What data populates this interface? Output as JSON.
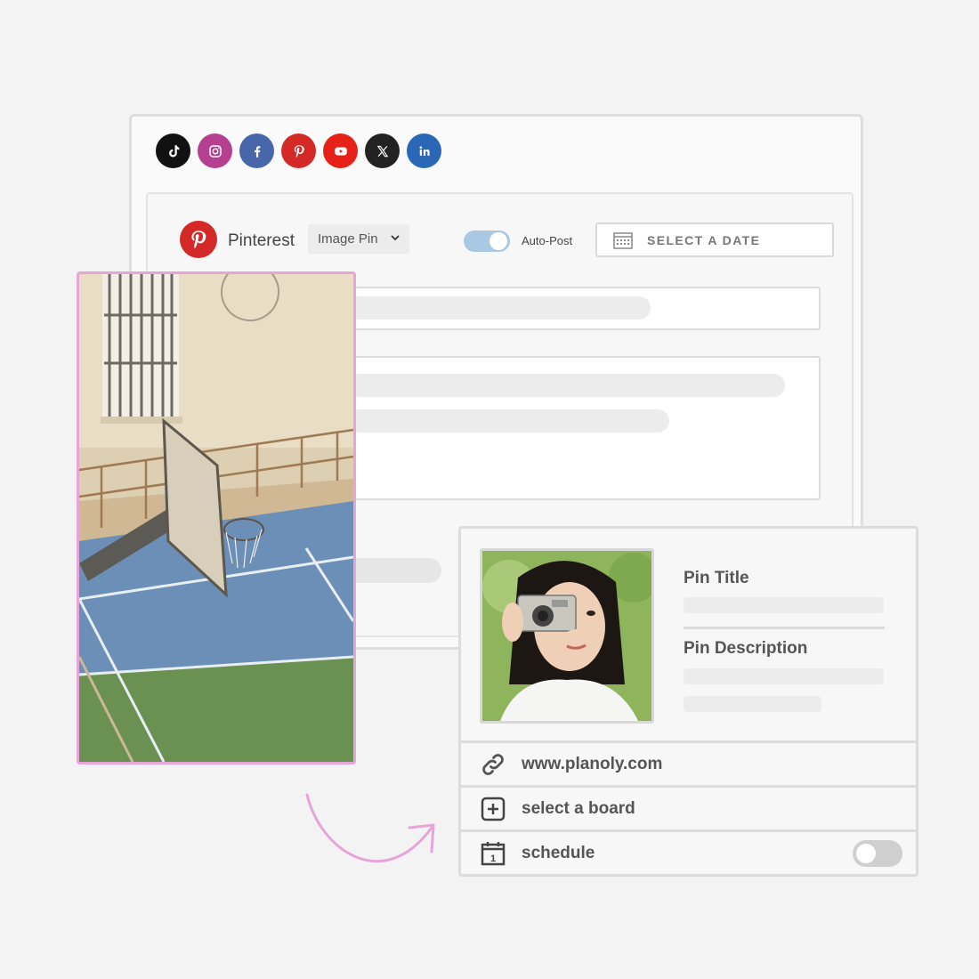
{
  "socials": [
    {
      "name": "tiktok-icon",
      "color": "#111111"
    },
    {
      "name": "instagram-icon",
      "color": "#b5408f"
    },
    {
      "name": "facebook-icon",
      "color": "#4867aa"
    },
    {
      "name": "pinterest-icon",
      "color": "#d42a27"
    },
    {
      "name": "youtube-icon",
      "color": "#e62117"
    },
    {
      "name": "x-icon",
      "color": "#222222"
    },
    {
      "name": "linkedin-icon",
      "color": "#2a67b7"
    }
  ],
  "editor": {
    "platform": "Pinterest",
    "pin_type": "Image Pin",
    "auto_post_label": "Auto-Post",
    "auto_post_enabled": true,
    "date_button": "SELECT A DATE"
  },
  "preview": {
    "title_label": "Pin Title",
    "description_label": "Pin Description",
    "link": "www.planoly.com",
    "board": "select a board",
    "schedule": "schedule",
    "schedule_enabled": false,
    "calendar_day": "1"
  },
  "colors": {
    "accent_pink": "#e7a4d9",
    "pinterest_red": "#d42a27",
    "toggle_blue": "#a8c8e3"
  }
}
